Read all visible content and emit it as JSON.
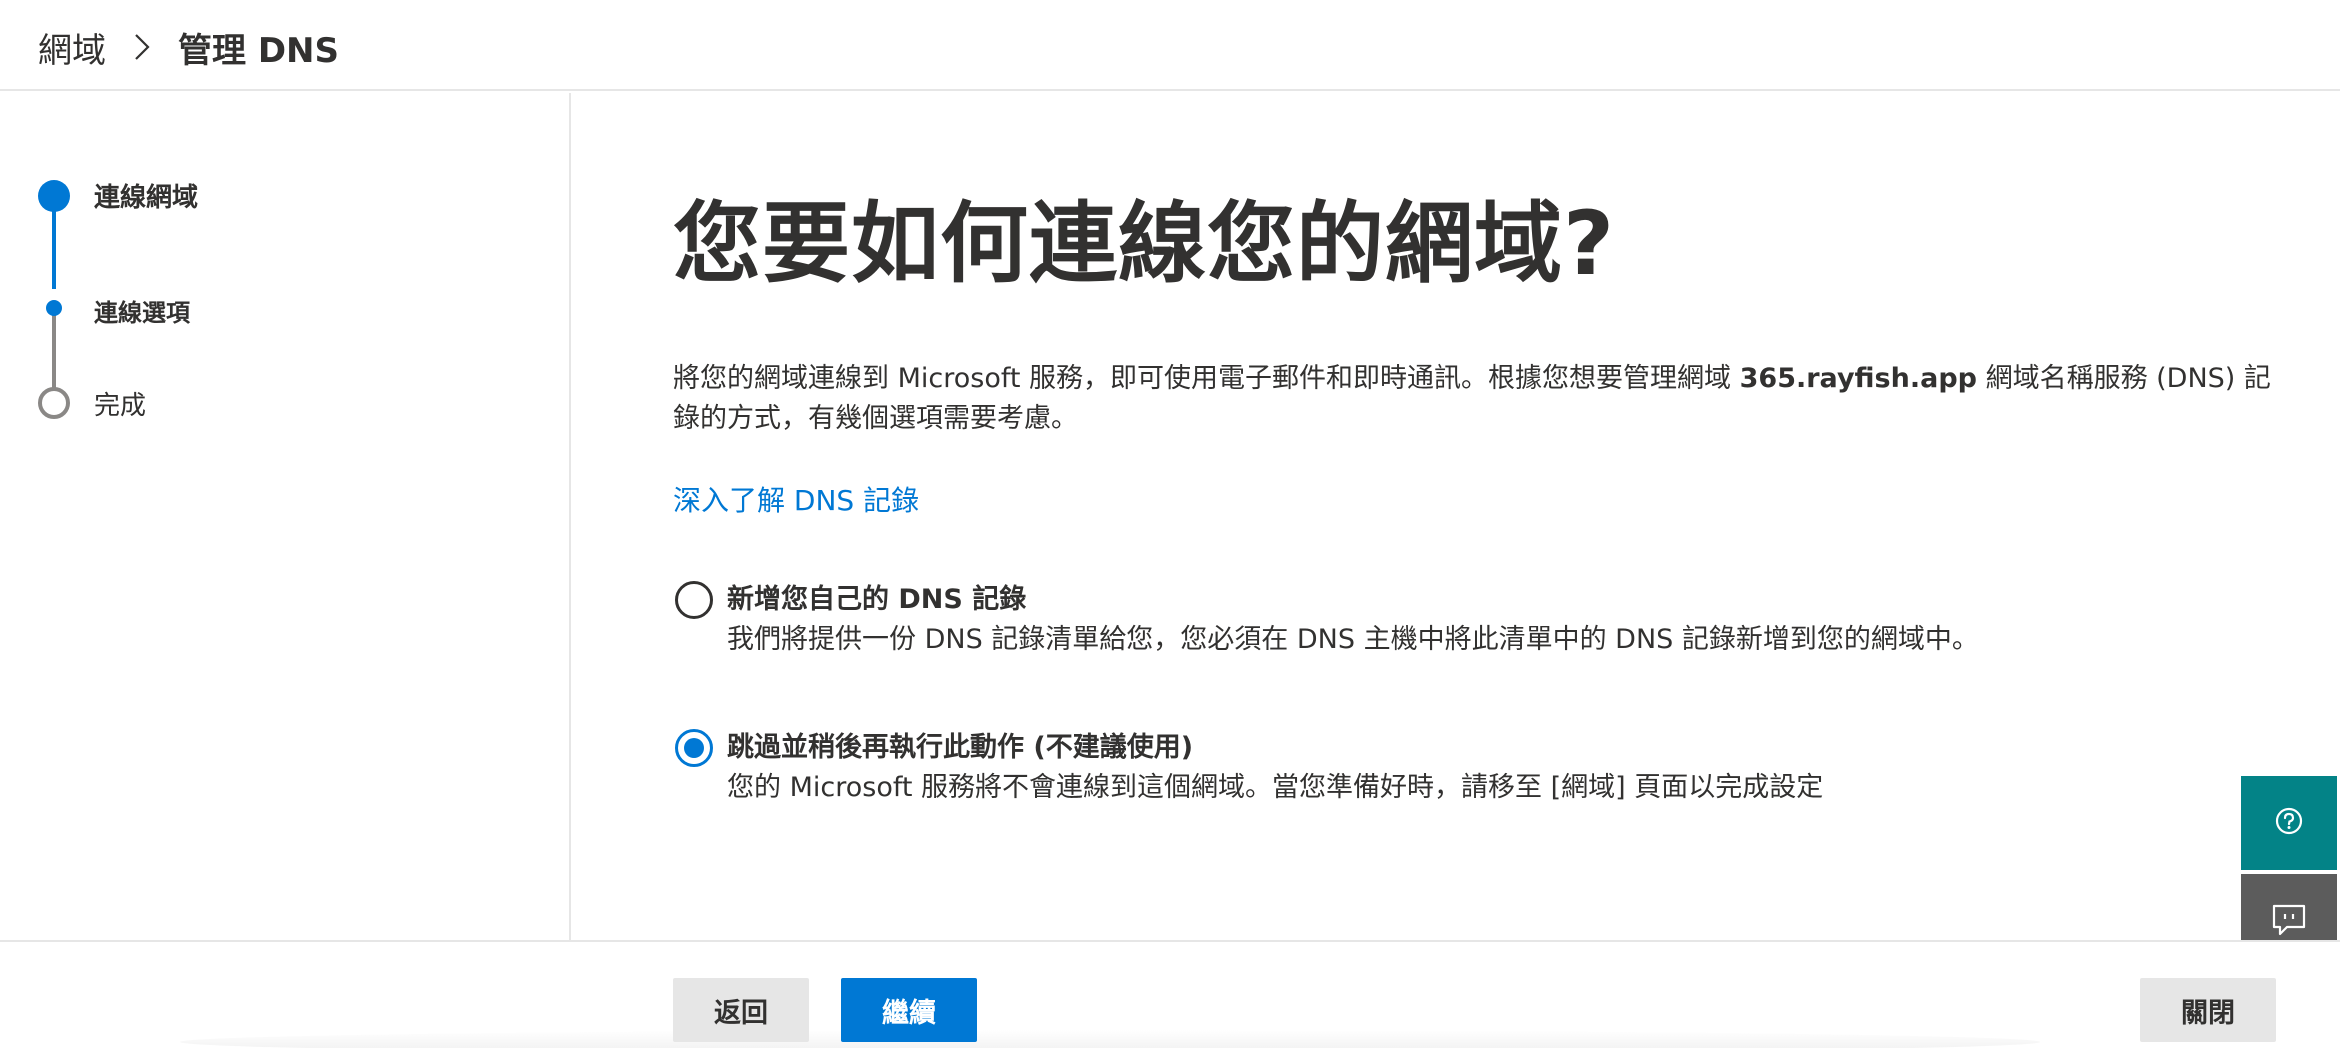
{
  "breadcrumb": {
    "root": "網域",
    "separator_icon": "chevron-right-icon",
    "current": "管理 DNS"
  },
  "steps": [
    {
      "label": "連線網域",
      "state": "current"
    },
    {
      "label": "連線選項",
      "state": "current-substep"
    },
    {
      "label": "完成",
      "state": "pending"
    }
  ],
  "main": {
    "title": "您要如何連線您的網域?",
    "description_before": "將您的網域連線到 Microsoft 服務，即可使用電子郵件和即時通訊。根據您想要管理網域 ",
    "description_domain": "365.rayfish.app",
    "description_after": " 網域名稱服務 (DNS) 記錄的方式，有幾個選項需要考慮。",
    "learn_link": "深入了解 DNS 記錄",
    "options": [
      {
        "title": "新增您自己的 DNS 記錄",
        "description": "我們將提供一份 DNS 記錄清單給您，您必須在 DNS 主機中將此清單中的 DNS 記錄新增到您的網域中。",
        "selected": false
      },
      {
        "title": "跳過並稍後再執行此動作 (不建議使用)",
        "description": "您的 Microsoft 服務將不會連線到這個網域。當您準備好時，請移至 [網域] 頁面以完成設定",
        "selected": true
      }
    ]
  },
  "footer": {
    "back_label": "返回",
    "continue_label": "繼續",
    "close_label": "關閉"
  },
  "floating": {
    "help_icon": "help-icon",
    "feedback_icon": "feedback-icon"
  },
  "colors": {
    "accent": "#0078d4",
    "help_bg": "#038387",
    "feedback_bg": "#5c5c5c",
    "text": "#323130"
  }
}
